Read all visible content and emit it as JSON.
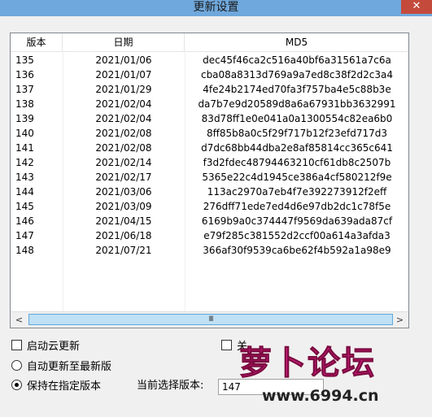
{
  "window": {
    "title": "更新设置",
    "close_glyph": "✕"
  },
  "table": {
    "columns": [
      "版本",
      "日期",
      "MD5"
    ],
    "rows": [
      {
        "version": "135",
        "date": "2021/01/06",
        "md5": "dec45f46ca2c516a40bf6a31561a7c6a"
      },
      {
        "version": "136",
        "date": "2021/01/07",
        "md5": "cba08a8313d769a9a7ed8c38f2d2c3a4"
      },
      {
        "version": "137",
        "date": "2021/01/29",
        "md5": "4fe24b2174ed70fa3f757ba4e5c88b3e"
      },
      {
        "version": "138",
        "date": "2021/02/04",
        "md5": "da7b7e9d20589d8a6a67931bb3632991"
      },
      {
        "version": "139",
        "date": "2021/02/04",
        "md5": "83d78ff1e0e041a0a1300554c82ea6b0"
      },
      {
        "version": "140",
        "date": "2021/02/08",
        "md5": "8ff85b8a0c5f29f717b12f23efd717d3"
      },
      {
        "version": "141",
        "date": "2021/02/08",
        "md5": "d7dc68bb44dba2e8af85814cc365c641"
      },
      {
        "version": "142",
        "date": "2021/02/14",
        "md5": "f3d2fdec48794463210cf61db8c2507b"
      },
      {
        "version": "143",
        "date": "2021/02/17",
        "md5": "5365e22c4d1945ce386a4cf580212f9e"
      },
      {
        "version": "144",
        "date": "2021/03/06",
        "md5": "113ac2970a7eb4f7e392273912f2eff"
      },
      {
        "version": "145",
        "date": "2021/03/09",
        "md5": "276dff71ede7ed4d6e97db2dc1c78f5e"
      },
      {
        "version": "146",
        "date": "2021/04/15",
        "md5": "6169b9a0c374447f9569da639ada87cf"
      },
      {
        "version": "147",
        "date": "2021/06/18",
        "md5": "e79f285c381552d2ccf00a614a3afda3"
      },
      {
        "version": "148",
        "date": "2021/07/21",
        "md5": "366af30f9539ca6be62f4b592a1a98e9"
      }
    ]
  },
  "scrollbar": {
    "left_arrow": "<",
    "right_arrow": ">",
    "thumb_grip": "III"
  },
  "options": {
    "enable_cloud_update": {
      "label": "启动云更新",
      "checked": false
    },
    "second_checkbox": {
      "label": "关",
      "checked": false
    },
    "auto_update_latest": {
      "label": "自动更新至最新版",
      "selected": false
    },
    "keep_specified_version": {
      "label": "保持在指定版本",
      "selected": true
    }
  },
  "current_version": {
    "label": "当前选择版本:",
    "value": "147"
  },
  "watermark": {
    "text": "萝卜论坛",
    "url": "www.6994.cn"
  },
  "colors": {
    "titlebar": "#6fa8dc",
    "close": "#c44b3c",
    "scroll_thumb": "#bfe0f5",
    "watermark": "#d81e8a"
  }
}
